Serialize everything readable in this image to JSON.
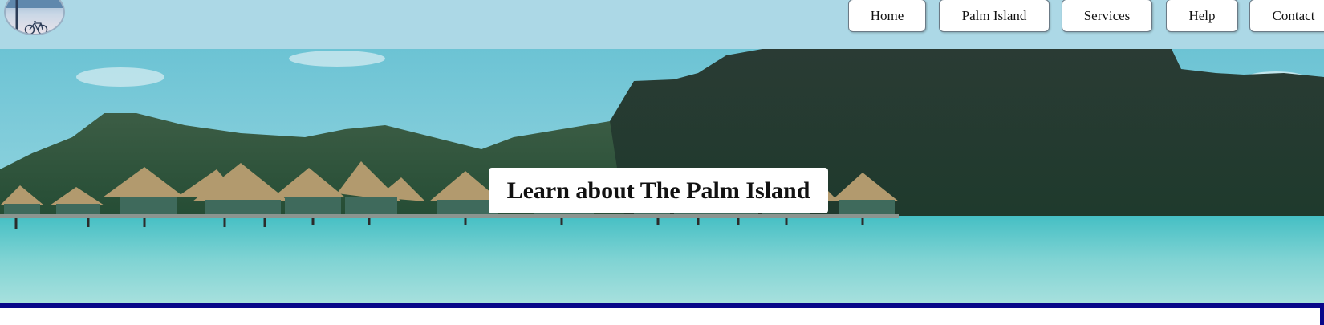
{
  "header": {
    "logo_icon": "bicycle-logo-icon",
    "nav": [
      {
        "label": "Home"
      },
      {
        "label": "Palm Island"
      },
      {
        "label": "Services"
      },
      {
        "label": "Help"
      },
      {
        "label": "Contact"
      }
    ],
    "colors": {
      "background": "#acd8e6",
      "button": "#ffffff"
    }
  },
  "hero": {
    "title": "Learn about The Palm Island",
    "image": "overwater-bungalows-island-photo"
  },
  "content": {
    "frame_color": "#08088a"
  }
}
